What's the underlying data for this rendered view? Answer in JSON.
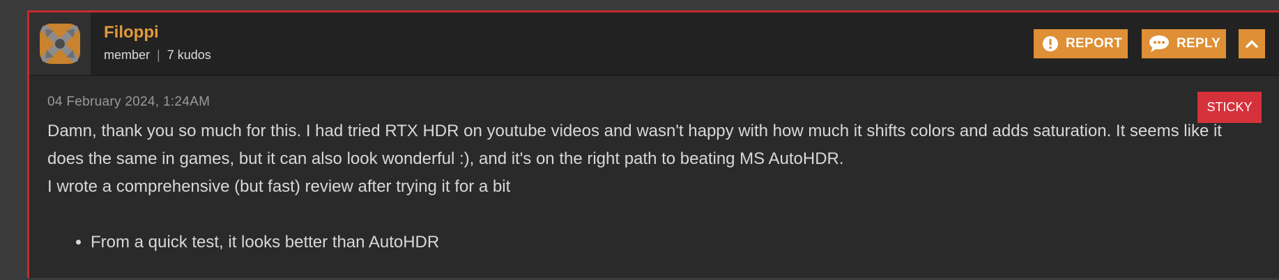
{
  "post": {
    "user": {
      "name": "Filoppi",
      "role": "member",
      "kudos": "7 kudos",
      "avatar_icon": "crossed-arrows-avatar-icon"
    },
    "actions": {
      "report_label": "REPORT",
      "report_icon": "alert-circle-icon",
      "reply_label": "REPLY",
      "reply_icon": "speech-bubble-icon",
      "collapse_icon": "chevron-up-icon"
    },
    "date": "04 February 2024, 1:24AM",
    "badge": "STICKY",
    "paragraphs": [
      "Damn, thank you so much for this. I had tried RTX HDR on youtube videos and wasn't happy with how much it shifts colors and adds saturation. It seems like it does the same in games, but it can also look wonderful :), and it's on the right path to beating MS AutoHDR.",
      "I wrote a comprehensive (but fast) review after trying it for a bit"
    ],
    "bullets": [
      "From a quick test, it looks better than AutoHDR"
    ]
  },
  "colors": {
    "accent": "#df8f35",
    "username": "#e39a3d",
    "sticky": "#d5313a",
    "border": "#c62b2b"
  }
}
